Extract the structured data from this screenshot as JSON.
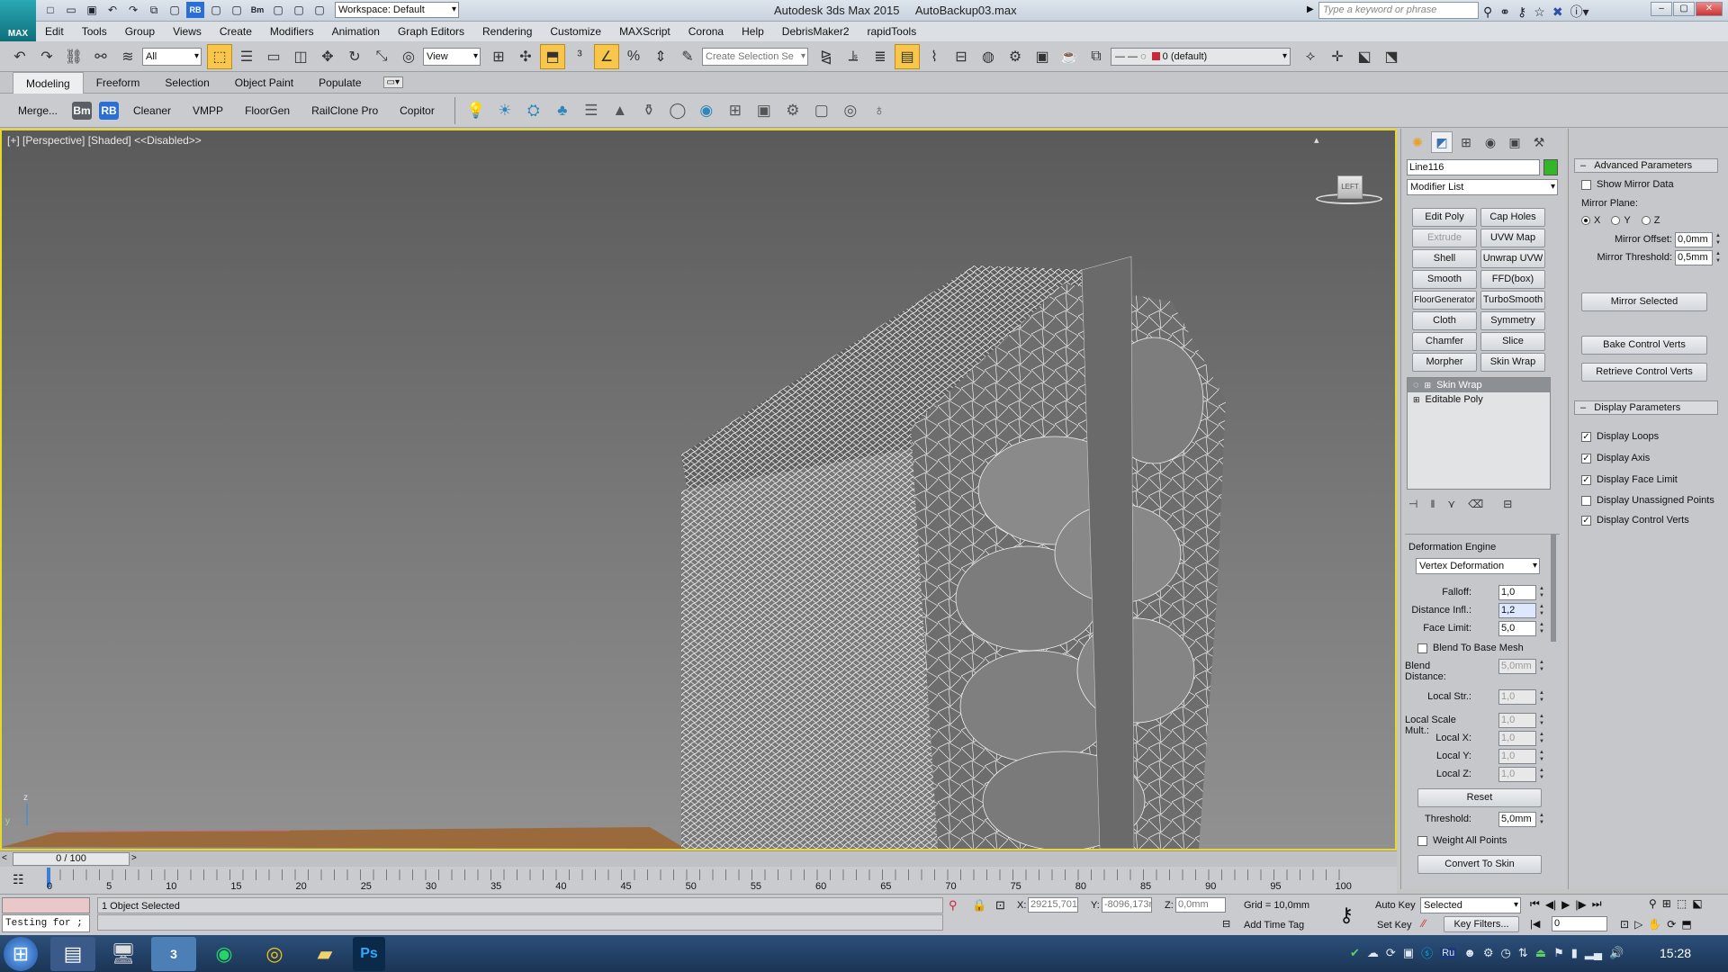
{
  "app": {
    "logo_text": "MAX",
    "title": "Autodesk 3ds Max  2015",
    "filename": "AutoBackup03.max",
    "workspace": "Workspace: Default",
    "search_placeholder": "Type a keyword or phrase"
  },
  "menu": [
    "Edit",
    "Tools",
    "Group",
    "Views",
    "Create",
    "Modifiers",
    "Animation",
    "Graph Editors",
    "Rendering",
    "Customize",
    "MAXScript",
    "Corona",
    "Help",
    "DebrisMaker2",
    "rapidTools"
  ],
  "toolbar": {
    "selection_filter": "All",
    "ref_coord": "View",
    "named_selection": "Create Selection Se",
    "layer": "0 (default)"
  },
  "ribbon": {
    "tabs": [
      "Modeling",
      "Freeform",
      "Selection",
      "Object Paint",
      "Populate"
    ],
    "active_tab": "Modeling",
    "buttons": [
      "Merge...",
      "Bm",
      "RB",
      "Cleaner",
      "VMPP",
      "FloorGen",
      "RailClone Pro",
      "Copitor"
    ]
  },
  "viewport": {
    "label": "[+] [Perspective] [Shaded]  <<Disabled>>",
    "viewcube_label": "LEFT",
    "axis_z": "z",
    "axis_y": "y"
  },
  "command_panel": {
    "object_name": "Line116",
    "object_color": "#35b52a",
    "modifier_list": "Modifier List",
    "modifier_buttons": [
      [
        "Edit Poly",
        "Cap Holes"
      ],
      [
        "Extrude",
        "UVW Map"
      ],
      [
        "Shell",
        "Unwrap UVW"
      ],
      [
        "Smooth",
        "FFD(box)"
      ],
      [
        "FloorGenerator",
        "TurboSmooth"
      ],
      [
        "Cloth",
        "Symmetry"
      ],
      [
        "Chamfer",
        "Slice"
      ],
      [
        "Morpher",
        "Skin Wrap"
      ]
    ],
    "stack": [
      "Skin Wrap",
      "Editable Poly"
    ],
    "params": {
      "engine_label": "Deformation Engine",
      "engine_value": "Vertex Deformation",
      "falloff_label": "Falloff:",
      "falloff": "1,0",
      "distance_label": "Distance Infl.:",
      "distance": "1,2",
      "face_limit_label": "Face Limit:",
      "face_limit": "5,0",
      "blend_label": "Blend To Base Mesh",
      "blend_distance_label": "Blend Distance:",
      "blend_distance": "5,0mm",
      "local_str_label": "Local Str.:",
      "local_str": "1,0",
      "local_scale_label": "Local Scale Mult.:",
      "local_scale": "1,0",
      "local_x_label": "Local X:",
      "local_x": "1,0",
      "local_y_label": "Local Y:",
      "local_y": "1,0",
      "local_z_label": "Local Z:",
      "local_z": "1,0",
      "reset": "Reset",
      "threshold_label": "Threshold:",
      "threshold": "5,0mm",
      "weight_label": "Weight All Points",
      "convert": "Convert To Skin"
    }
  },
  "advanced": {
    "header": "Advanced Parameters",
    "show_mirror": "Show Mirror Data",
    "mirror_plane": "Mirror Plane:",
    "axes": [
      "X",
      "Y",
      "Z"
    ],
    "mirror_offset_label": "Mirror Offset:",
    "mirror_offset": "0,0mm",
    "mirror_threshold_label": "Mirror Threshold:",
    "mirror_threshold": "0,5mm",
    "mirror_selected": "Mirror Selected",
    "bake": "Bake Control Verts",
    "retrieve": "Retrieve Control Verts",
    "display_header": "Display Parameters",
    "display_items": [
      {
        "label": "Display Loops",
        "checked": true
      },
      {
        "label": "Display Axis",
        "checked": true
      },
      {
        "label": "Display Face Limit",
        "checked": true
      },
      {
        "label": "Display Unassigned Points",
        "checked": false
      },
      {
        "label": "Display Control Verts",
        "checked": true
      }
    ]
  },
  "timeline": {
    "frame": "0 / 100",
    "ticks": [
      "0",
      "5",
      "10",
      "15",
      "20",
      "25",
      "30",
      "35",
      "40",
      "45",
      "50",
      "55",
      "60",
      "65",
      "70",
      "75",
      "80",
      "85",
      "90",
      "95",
      "100"
    ]
  },
  "status": {
    "selection": "1 Object Selected",
    "script": "Testing for ;",
    "x_label": "X:",
    "x": "29215,701",
    "y_label": "Y:",
    "y": "-8096,173r",
    "z_label": "Z:",
    "z": "0,0mm",
    "grid": "Grid = 10,0mm",
    "auto_key": "Auto Key",
    "selected": "Selected",
    "set_key": "Set Key",
    "key_filters": "Key Filters...",
    "add_time_tag": "Add Time Tag",
    "frame_field": "0"
  },
  "taskbar": {
    "clock": "15:28",
    "lang": "Ru"
  }
}
